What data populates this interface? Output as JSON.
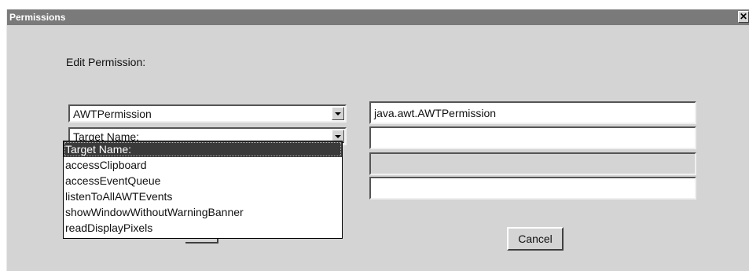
{
  "window": {
    "title": "Permissions",
    "close_glyph": "✕"
  },
  "form": {
    "heading": "Edit Permission:",
    "permission_combo": {
      "value": "AWTPermission"
    },
    "target_combo": {
      "value": "Target Name:"
    },
    "permission_class_field": {
      "value": "java.awt.AWTPermission"
    },
    "target_field": {
      "value": ""
    },
    "actions_field": {
      "value": ""
    },
    "signed_by_field": {
      "value": ""
    },
    "dropdown_items": [
      "Target Name:",
      "accessClipboard",
      "accessEventQueue",
      "listenToAllAWTEvents",
      "showWindowWithoutWarningBanner",
      "readDisplayPixels"
    ],
    "cancel_label": "Cancel"
  }
}
